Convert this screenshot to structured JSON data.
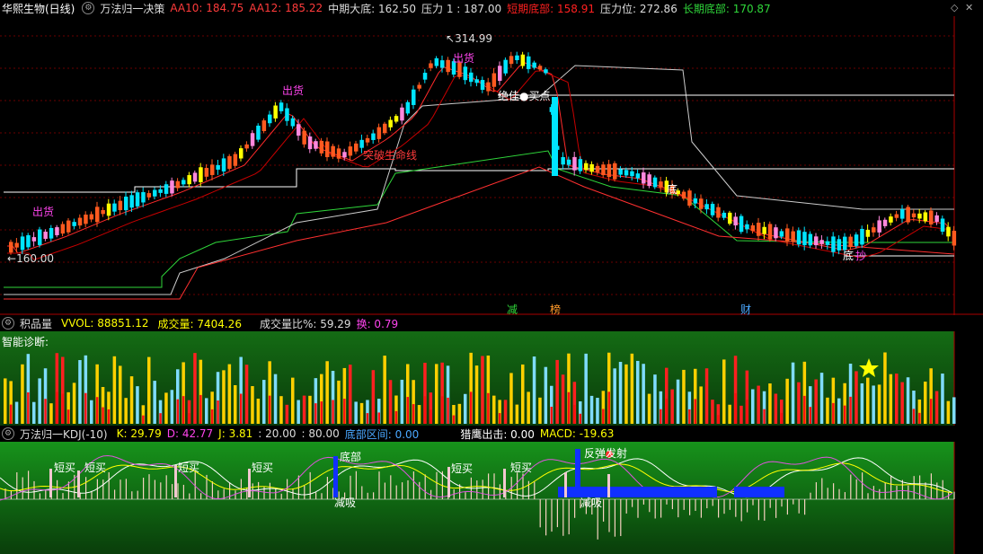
{
  "topbar": {
    "stock": "华熙生物(日线)",
    "indicator": "万法归一决策",
    "aa10": "AA10: 184.75",
    "aa12": "AA12: 185.22",
    "mid_bottom": "中期大底: 162.50",
    "pressure1": "压力 1 : 187.00",
    "short_bottom": "短期底部: 158.91",
    "pressure_pos": "压力位: 272.86",
    "long_bottom": "长期底部: 170.87"
  },
  "main": {
    "high_label": "314.99",
    "low_label": "160.00",
    "labels": {
      "out1": "出货",
      "out2": "出货",
      "out3": "出货",
      "breakout": "突破生命线",
      "best_buy": "绝佳●买点",
      "di": "底",
      "di2": "底",
      "chao": "抄"
    },
    "bottom_tags": {
      "jian": "减",
      "bang": "榜",
      "cai": "财"
    }
  },
  "volbar": {
    "title": "积品量",
    "vvol": "VVOL: 88851.12",
    "turnover": "成交量: 7404.26",
    "ratio": "成交量比%: 59.29",
    "huan": "换: 0.79",
    "diagnosis": "智能诊断:"
  },
  "kdjbar": {
    "title": "万法归一KDJ(-10)",
    "k": "K: 29.79",
    "d": "D: 42.77",
    "j": "J: 3.81",
    "l20": ": 20.00",
    "l80": ": 80.00",
    "zone": "底部区间: 0.00",
    "eagle": "猎鹰出击: 0.00",
    "macd": "MACD: -19.63"
  },
  "kdj_labels": {
    "short_buy": "短买",
    "bottom": "底部",
    "shao_xi": "减吸",
    "jian_bi": "减吸",
    "rebound": "反弹发射"
  },
  "colors": {
    "up": "#ff5a1f",
    "down": "#00e5ff",
    "white": "#ffffff",
    "pink": "#ff88dd",
    "yellow": "#ffff00",
    "green": "#2fd63a",
    "blue": "#1030ff"
  }
}
